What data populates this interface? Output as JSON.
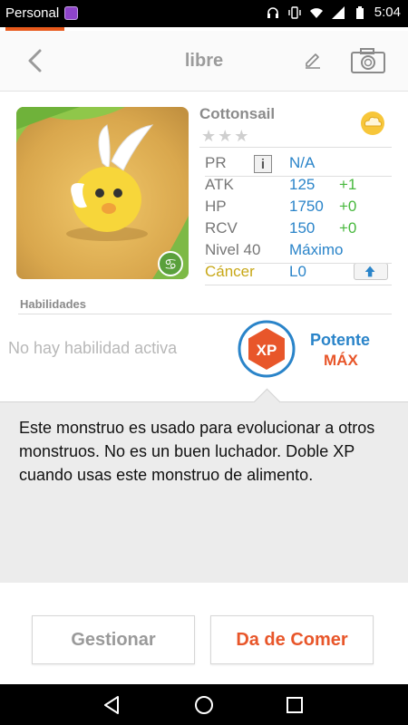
{
  "status_bar": {
    "carrier": "Personal",
    "time": "5:04"
  },
  "header": {
    "title": "libre"
  },
  "monster": {
    "name": "Cottonsail",
    "stars": "★★★",
    "stats": [
      {
        "label": "PR",
        "value": "N/A",
        "bonus": ""
      },
      {
        "label": "ATK",
        "value": "125",
        "bonus": "+1"
      },
      {
        "label": "HP",
        "value": "1750",
        "bonus": "+0"
      },
      {
        "label": "RCV",
        "value": "150",
        "bonus": "+0"
      },
      {
        "label": "Nivel 40",
        "value": "Máximo",
        "bonus": ""
      },
      {
        "label": "Cáncer",
        "value": "L0",
        "bonus": ""
      }
    ],
    "info_glyph": "i"
  },
  "abilities": {
    "title": "Habilidades",
    "active_skill": "No hay habilidad activa",
    "badge_text": "XP",
    "potency": "Potente",
    "potency_level": "MÁX"
  },
  "description": "Este monstruo es usado para evolucionar a otros monstruos. No es un buen luchador. Doble XP cuando usas este monstruo de alimento.",
  "buttons": {
    "manage": "Gestionar",
    "feed": "Da de Comer"
  },
  "colors": {
    "accent_blue": "#2a84c9",
    "accent_orange": "#e8562a",
    "bonus_green": "#47b83d",
    "sign_gold": "#c8a818"
  },
  "icons": [
    "back-arrow-icon",
    "edit-pencil-icon",
    "camera-icon",
    "cloud-element-icon",
    "info-icon",
    "level-up-arrow-icon",
    "cancer-zodiac-icon",
    "xp-badge-icon",
    "nav-back-icon",
    "nav-home-icon",
    "nav-recents-icon"
  ]
}
